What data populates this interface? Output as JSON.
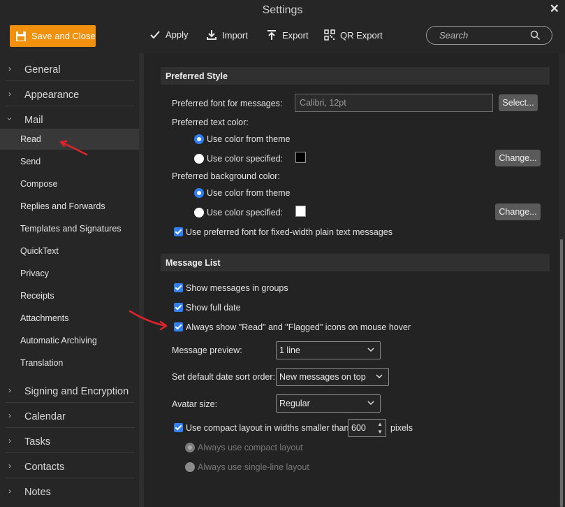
{
  "window": {
    "title": "Settings"
  },
  "toolbar": {
    "save_label": "Save and Close",
    "apply_label": "Apply",
    "import_label": "Import",
    "export_label": "Export",
    "qr_label": "QR Export",
    "search_placeholder": "Search"
  },
  "sidebar": {
    "sections": [
      "General",
      "Appearance",
      "Mail",
      "Signing and Encryption",
      "Calendar",
      "Tasks",
      "Contacts",
      "Notes"
    ],
    "mail_items": [
      "Read",
      "Send",
      "Compose",
      "Replies and Forwards",
      "Templates and Signatures",
      "QuickText",
      "Privacy",
      "Receipts",
      "Attachments",
      "Automatic Archiving",
      "Translation"
    ],
    "active_item": "Read"
  },
  "preferred_style": {
    "header": "Preferred Style",
    "font_label": "Preferred font for messages:",
    "font_value": "Calibri, 12pt",
    "select_label": "Select...",
    "text_color_label": "Preferred text color:",
    "bg_color_label": "Preferred background color:",
    "use_theme": "Use color from theme",
    "use_specified": "Use color specified:",
    "change_label": "Change...",
    "text_color_value": "#000000",
    "bg_color_value": "#ffffff",
    "fixed_width": "Use preferred font for fixed-width plain text messages"
  },
  "message_list": {
    "header": "Message List",
    "show_groups": "Show messages in groups",
    "show_full_date": "Show full date",
    "always_show_icons": "Always show \"Read\" and \"Flagged\" icons on mouse hover",
    "preview_label": "Message preview:",
    "preview_value": "1 line",
    "sort_label": "Set default date sort order:",
    "sort_value": "New messages on top",
    "avatar_label": "Avatar size:",
    "avatar_value": "Regular",
    "compact_label": "Use compact layout in widths smaller than",
    "compact_width": "600",
    "pixels_label": "pixels",
    "always_compact": "Always use compact layout",
    "always_single": "Always use single-line layout"
  },
  "colors": {
    "accent": "#f0900c",
    "checkbox": "#2f7ff0",
    "annotation": "#e0222a"
  }
}
